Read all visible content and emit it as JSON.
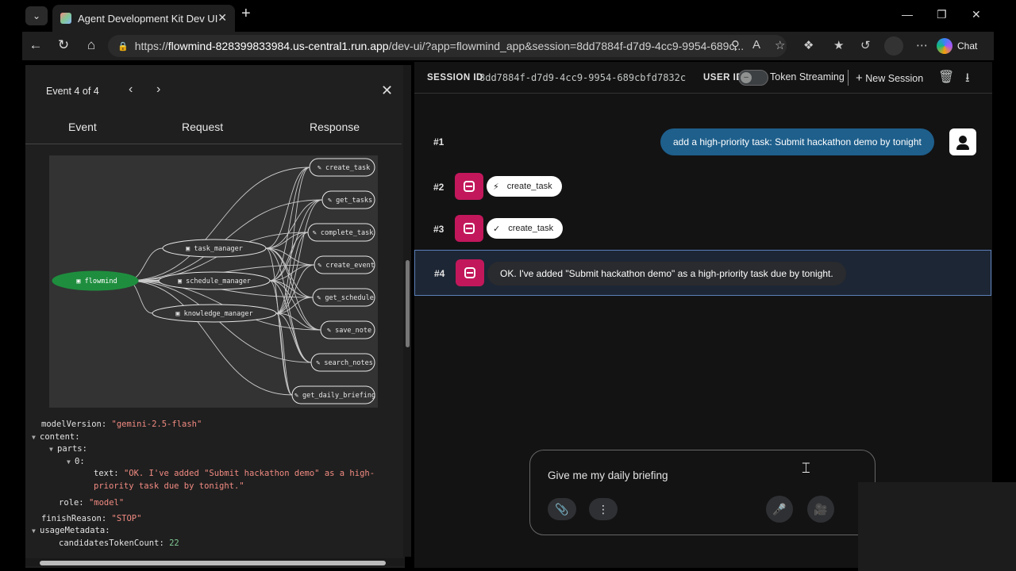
{
  "browser": {
    "tab_title": "Agent Development Kit Dev UI",
    "url_prefix": "https://",
    "url_host": "flowmind-828399833984.us-central1.run.app",
    "url_rest": "/dev-ui/?app=flowmind_app&session=8dd7884f-d7d9-4cc9-9954-689c...",
    "chat_label": "Chat"
  },
  "event_panel": {
    "counter": "Event 4 of 4",
    "tabs": [
      "Event",
      "Request",
      "Response"
    ],
    "graph": {
      "root": "flowmind",
      "agents": [
        "task_manager",
        "schedule_manager",
        "knowledge_manager"
      ],
      "tools": [
        "create_task",
        "get_tasks",
        "complete_task",
        "create_event",
        "get_schedule",
        "save_note",
        "search_notes",
        "get_daily_briefing"
      ]
    },
    "code": {
      "modelVersion_key": "modelVersion",
      "modelVersion_val": "\"gemini-2.5-flash\"",
      "content_key": "content",
      "parts_key": "parts",
      "index_key": "0",
      "text_key": "text",
      "text_val_line1": "\"OK. I've added \"Submit hackathon demo\" as a high-",
      "text_val_line2": "priority task due by tonight.\"",
      "role_key": "role",
      "role_val": "\"model\"",
      "finishReason_key": "finishReason",
      "finishReason_val": "\"STOP\"",
      "usageMetadata_key": "usageMetadata",
      "candidatesTokenCount_key": "candidatesTokenCount",
      "candidatesTokenCount_val": "22"
    }
  },
  "session_header": {
    "session_id_label": "SESSION ID",
    "session_id": "8dd7884f-d7d9-4cc9-9954-689cbfd7832c",
    "user_id_label": "USER ID",
    "token_streaming": "Token Streaming",
    "new_session": "New Session"
  },
  "messages": [
    {
      "num": "#1",
      "text": "add a high-priority task: Submit hackathon demo by tonight"
    },
    {
      "num": "#2",
      "text": "create_task"
    },
    {
      "num": "#3",
      "text": "create_task"
    },
    {
      "num": "#4",
      "text": "OK. I've added \"Submit hackathon demo\" as a high-priority task due by tonight."
    }
  ],
  "input": {
    "value": "Give me my daily briefing"
  },
  "colors": {
    "bot_avatar": "#c2185b",
    "user_bubble": "#1e5f8c",
    "selected_row_border": "#5b7fb8",
    "graph_root": "#1e8e3e"
  }
}
